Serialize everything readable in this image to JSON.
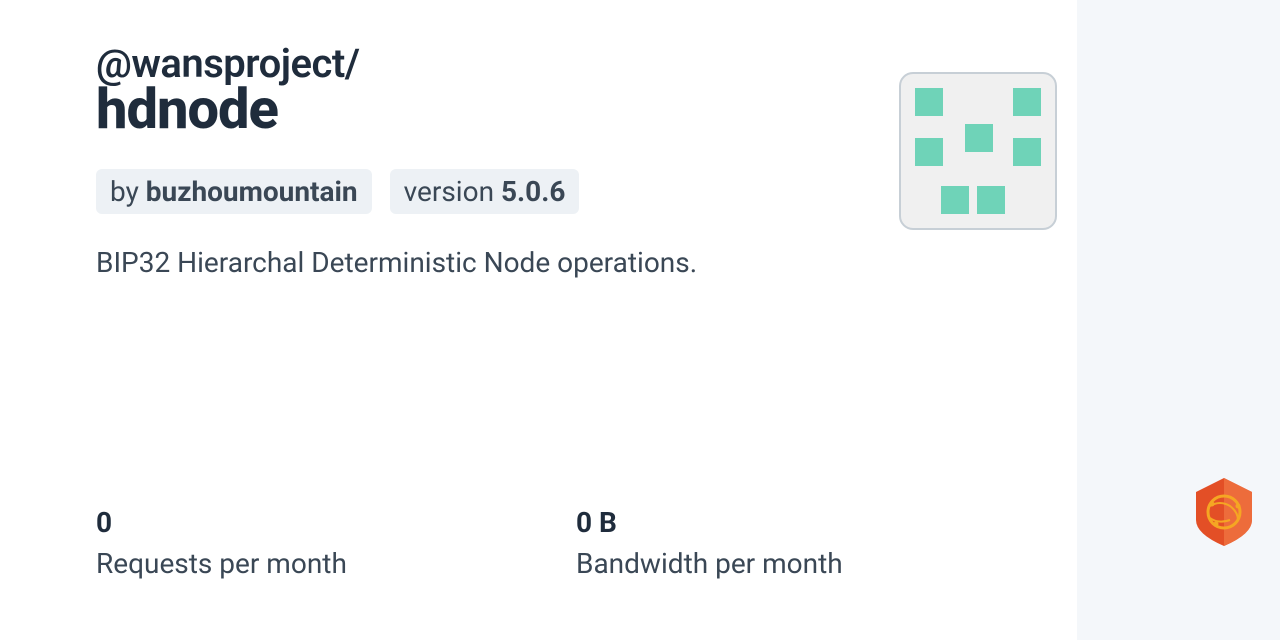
{
  "package": {
    "scope": "@wansproject/",
    "name": "hdnode",
    "author_prefix": "by ",
    "author": "buzhoumountain",
    "version_prefix": "version ",
    "version": "5.0.6",
    "description": "BIP32 Hierarchal Deterministic Node operations."
  },
  "stats": {
    "requests": {
      "value": "0",
      "label": "Requests per month"
    },
    "bandwidth": {
      "value": "0 B",
      "label": "Bandwidth per month"
    }
  }
}
